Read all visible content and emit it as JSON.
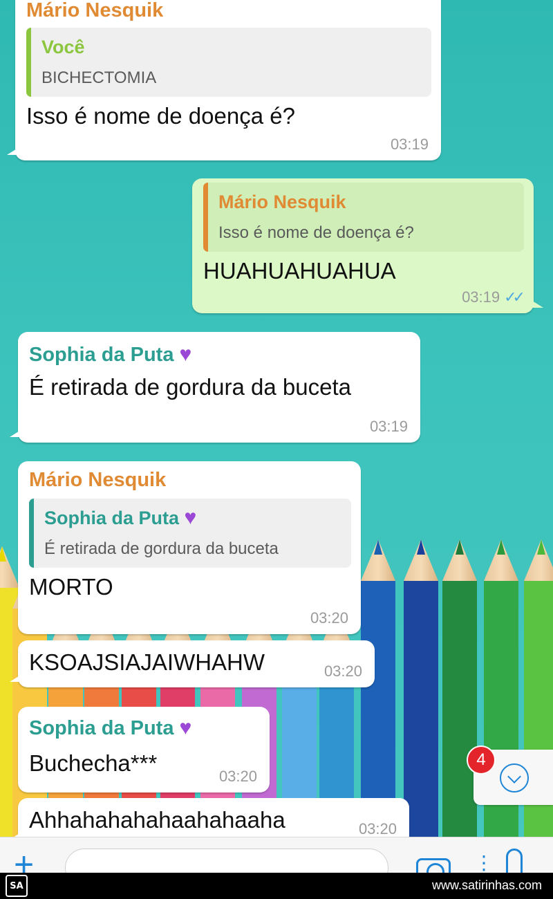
{
  "colors": {
    "wallpaper": "#3cc3bc",
    "incoming_bubble": "#ffffff",
    "outgoing_bubble": "#dcf8c6",
    "name_orange": "#e08a34",
    "name_teal": "#2b9d91",
    "quote_bar_green": "#8cc63e",
    "quote_bar_orange": "#e08a34",
    "quote_bar_teal": "#2b9d91",
    "accent_blue": "#1f86d7"
  },
  "messages": [
    {
      "sender": "Mário Nesquik",
      "quote": {
        "name": "Você",
        "text": "BICHECTOMIA"
      },
      "text": "Isso é nome de doença é?",
      "time": "03:19"
    },
    {
      "quote": {
        "name": "Mário Nesquik",
        "text": "Isso é nome de doença é?"
      },
      "text": "HUAHUAHUAHUA",
      "time": "03:19",
      "status_icon": "double-check-icon"
    },
    {
      "sender": "Sophia da Puta",
      "sender_icon": "purple-heart-icon",
      "text": "É retirada de gordura da buceta",
      "time": "03:19"
    },
    {
      "sender": "Mário Nesquik",
      "quote": {
        "name": "Sophia da Puta",
        "name_icon": "purple-heart-icon",
        "text": "É retirada de gordura da buceta"
      },
      "text": "MORTO",
      "time": "03:20"
    },
    {
      "text": "KSOAJSIAJAIWHAHW",
      "time": "03:20"
    },
    {
      "sender": "Sophia da Puta",
      "sender_icon": "purple-heart-icon",
      "text": "Buchecha***",
      "time": "03:20"
    },
    {
      "text": "Ahhahahahahaahahaaha",
      "time": "03:20"
    }
  ],
  "unread_badge": "4",
  "input_bar": {
    "icons": [
      "plus-icon",
      "camera-icon",
      "dots-icon",
      "microphone-icon"
    ]
  },
  "footer": {
    "logo_text": "SA",
    "url": "www.satirinhas.com"
  }
}
